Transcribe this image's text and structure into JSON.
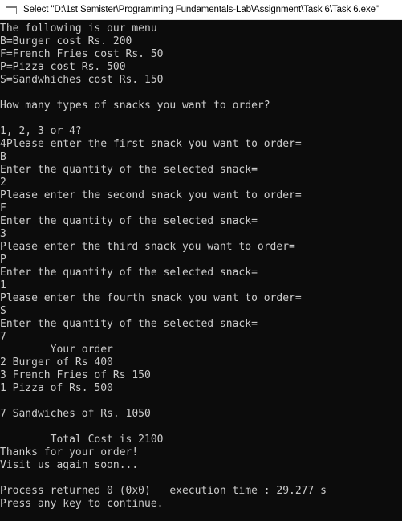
{
  "window": {
    "title": "Select \"D:\\1st Semister\\Programming Fundamentals-Lab\\Assignment\\Task 6\\Task 6.exe\""
  },
  "console": {
    "lines": [
      "The following is our menu",
      "B=Burger cost Rs. 200",
      "F=French Fries cost Rs. 50",
      "P=Pizza cost Rs. 500",
      "S=Sandwhiches cost Rs. 150",
      "",
      "How many types of snacks you want to order?",
      "",
      "1, 2, 3 or 4?",
      "4Please enter the first snack you want to order=",
      "B",
      "Enter the quantity of the selected snack=",
      "2",
      "Please enter the second snack you want to order=",
      "F",
      "Enter the quantity of the selected snack=",
      "3",
      "Please enter the third snack you want to order=",
      "P",
      "Enter the quantity of the selected snack=",
      "1",
      "Please enter the fourth snack you want to order=",
      "S",
      "Enter the quantity of the selected snack=",
      "7",
      "        Your order",
      "2 Burger of Rs 400",
      "3 French Fries of Rs 150",
      "1 Pizza of Rs. 500",
      "",
      "7 Sandwiches of Rs. 1050",
      "",
      "        Total Cost is 2100",
      "Thanks for your order!",
      "Visit us again soon...",
      "",
      "Process returned 0 (0x0)   execution time : 29.277 s",
      "Press any key to continue."
    ]
  }
}
